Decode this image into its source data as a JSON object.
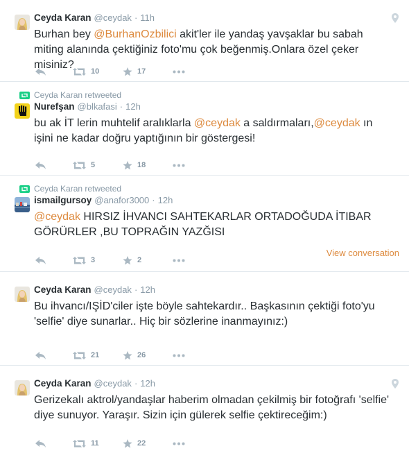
{
  "colors": {
    "mention": "#dd8a3e",
    "meta": "#8899a6",
    "text": "#292f33",
    "divider": "#e1e8ed"
  },
  "tweets": [
    {
      "retweeted_by": "",
      "fullname": "Ceyda Karan",
      "username": "@ceydak",
      "dot": "·",
      "time": "11h",
      "has_geo": true,
      "avatar": "woman-blonde",
      "text_parts": [
        {
          "t": "Burhan bey "
        },
        {
          "t": "@BurhanOzbilici",
          "mention": true
        },
        {
          "t": " akit'ler ile yandaş yavşaklar bu sabah miting alanında çektiğiniz foto'mu çok beğenmiş.Onlara özel çeker misiniz?"
        }
      ],
      "retweets": "10",
      "favorites": "17",
      "view_conversation": ""
    },
    {
      "retweeted_by": "Ceyda Karan retweeted",
      "fullname": "Nurefşan",
      "username": "@blkafasi",
      "dot": "·",
      "time": "12h",
      "has_geo": false,
      "avatar": "rabia-yellow",
      "text_parts": [
        {
          "t": "bu ak İT lerin muhtelif aralıklarla "
        },
        {
          "t": "@ceydak",
          "mention": true
        },
        {
          "t": " a saldırmaları,"
        },
        {
          "t": "@ceydak",
          "mention": true
        },
        {
          "t": " ın işini ne kadar doğru yaptığının bir göstergesi!"
        }
      ],
      "retweets": "5",
      "favorites": "18",
      "view_conversation": ""
    },
    {
      "retweeted_by": "Ceyda Karan retweeted",
      "fullname": "ismailgursoy",
      "username": "@anafor3000",
      "dot": "·",
      "time": "12h",
      "has_geo": false,
      "avatar": "harbor-photo",
      "text_parts": [
        {
          "t": "@ceydak",
          "mention": true
        },
        {
          "t": " HIRSIZ İHVANCI SAHTEKARLAR ORTADOĞUDA  İTIBAR GÖRÜRLER ,BU TOPRAĞIN YAZĞISI"
        }
      ],
      "retweets": "3",
      "favorites": "2",
      "view_conversation": "View conversation"
    },
    {
      "retweeted_by": "",
      "fullname": "Ceyda Karan",
      "username": "@ceydak",
      "dot": "·",
      "time": "12h",
      "has_geo": false,
      "avatar": "woman-blonde",
      "text_parts": [
        {
          "t": "Bu ihvancı/IŞİD'ciler işte böyle sahtekardır.. Başkasının çektiği foto'yu 'selfie' diye sunarlar.. Hiç bir sözlerine inanmayınız:)"
        }
      ],
      "retweets": "21",
      "favorites": "26",
      "view_conversation": ""
    },
    {
      "retweeted_by": "",
      "fullname": "Ceyda Karan",
      "username": "@ceydak",
      "dot": "·",
      "time": "12h",
      "has_geo": true,
      "avatar": "woman-blonde",
      "text_parts": [
        {
          "t": "Gerizekalı aktrol/yandaşlar haberim olmadan çekilmiş bir fotoğrafı 'selfie' diye sunuyor. Yaraşır. Sizin için gülerek selfie çektireceğim:)"
        }
      ],
      "retweets": "11",
      "favorites": "22",
      "view_conversation": ""
    }
  ]
}
